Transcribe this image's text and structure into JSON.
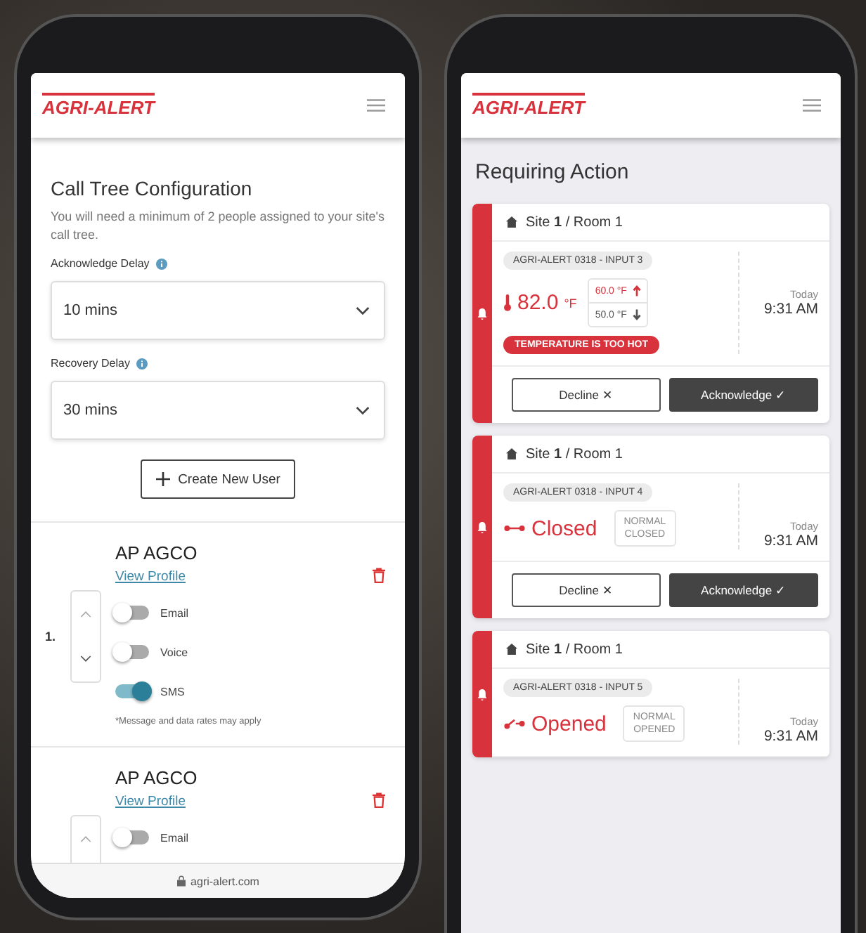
{
  "left_phone": {
    "logo": "AGRI-ALERT",
    "title": "Call Tree Configuration",
    "description": "You will need a minimum of 2 people assigned to your site's call tree.",
    "delays": [
      {
        "label": "Acknowledge Delay",
        "value": "10 mins"
      },
      {
        "label": "Recovery Delay",
        "value": "30 mins"
      }
    ],
    "create_button": "Create New User",
    "users": [
      {
        "number": "1.",
        "name": "AP AGCO",
        "link": "View Profile",
        "channels": [
          {
            "label": "Email",
            "on": false
          },
          {
            "label": "Voice",
            "on": false
          },
          {
            "label": "SMS",
            "on": true
          }
        ],
        "note": "*Message and data rates may apply"
      },
      {
        "name": "AP AGCO",
        "link": "View Profile",
        "channels": [
          {
            "label": "Email",
            "on": false
          }
        ]
      }
    ],
    "url": "agri-alert.com"
  },
  "right_phone": {
    "logo": "AGRI-ALERT",
    "title": "Requiring Action",
    "alerts": [
      {
        "kind": "temperature",
        "location": "Site **1** / Room 1",
        "chip": "AGRI-ALERT 0318 - INPUT 3",
        "reading": "82.0",
        "unit": "°F",
        "high": "60.0 °F",
        "low": "50.0 °F",
        "status": "TEMPERATURE IS TOO HOT",
        "day": "Today",
        "time": "9:31 AM",
        "actions": [
          "Decline ✕",
          "Acknowledge ✓"
        ]
      },
      {
        "kind": "closed",
        "location": "Site **1** / Room 1",
        "chip": "AGRI-ALERT 0318 - INPUT 4",
        "reading": "Closed",
        "normal": "NORMAL CLOSED",
        "day": "Today",
        "time": "9:31 AM",
        "actions": [
          "Decline ✕",
          "Acknowledge ✓"
        ]
      },
      {
        "kind": "opened",
        "location": "Site **1** / Room 1",
        "chip": "AGRI-ALERT 0318 - INPUT 5",
        "reading": "Opened",
        "normal": "NORMAL OPENED",
        "day": "Today",
        "time": "9:31 AM"
      }
    ]
  }
}
